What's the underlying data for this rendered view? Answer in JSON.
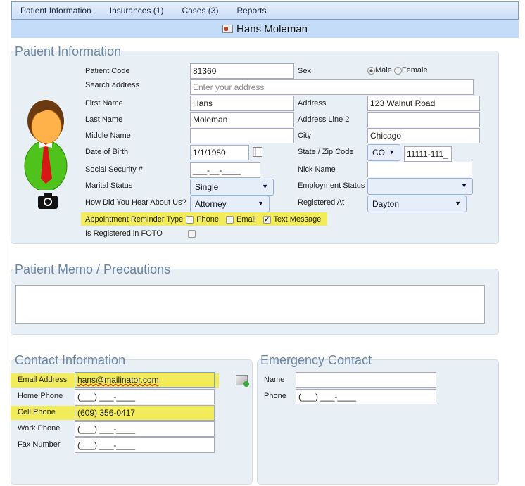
{
  "nav": {
    "tabs": [
      "Patient Information",
      "Insurances (1)",
      "Cases (3)",
      "Reports"
    ]
  },
  "title": {
    "patient_name": "Hans Moleman",
    "icon": "patient-card-icon"
  },
  "patient": {
    "heading": "Patient Information",
    "patient_code_label": "Patient Code",
    "patient_code": "81360",
    "sex_label": "Sex",
    "sex_options": [
      "Male",
      "Female"
    ],
    "sex_selected": "Male",
    "search_label": "Search address",
    "search_placeholder": "Enter your address",
    "first_name_label": "First Name",
    "first_name": "Hans",
    "address_label": "Address",
    "address": "123 Walnut Road",
    "last_name_label": "Last Name",
    "last_name": "Moleman",
    "address2_label": "Address Line 2",
    "address2": "",
    "middle_label": "Middle Name",
    "middle": "",
    "city_label": "City",
    "city": "Chicago",
    "dob_label": "Date of Birth",
    "dob": "1/1/1980",
    "state_zip_label": "State / Zip Code",
    "state": "CO",
    "zip": "11111-111_",
    "ssn_label": "Social Security #",
    "ssn": "___-__-____",
    "nick_label": "Nick Name",
    "nick": "",
    "marital_label": "Marital Status",
    "marital": "Single",
    "employment_label": "Employment Status",
    "employment": "",
    "hear_label": "How Did You Hear About Us?",
    "hear": "Attorney",
    "registered_at_label": "Registered At",
    "registered_at": "Dayton",
    "reminder_label": "Appointment Reminder Type",
    "reminders": [
      {
        "label": "Phone",
        "checked": false
      },
      {
        "label": "Email",
        "checked": false
      },
      {
        "label": "Text Message",
        "checked": true
      }
    ],
    "foto_label": "Is Registered in FOTO",
    "foto": false
  },
  "memo": {
    "heading": "Patient Memo / Precautions",
    "value": ""
  },
  "contact": {
    "heading": "Contact Information",
    "email_label": "Email Address",
    "email": "hans@mailinator.com",
    "home_label": "Home Phone",
    "home": "(___) ___-____",
    "cell_label": "Cell Phone",
    "cell": "(609) 356-0417",
    "work_label": "Work Phone",
    "work": "(___) ___-____",
    "fax_label": "Fax Number",
    "fax": "(___) ___-____"
  },
  "emergency": {
    "heading": "Emergency Contact",
    "name_label": "Name",
    "name": "",
    "phone_label": "Phone",
    "phone": "(___) ___-____"
  },
  "colors": {
    "highlight": "#f2ec5a",
    "heading": "#6a86a5",
    "panel": "#e8eff5",
    "titlebar": "#c4dcf7"
  }
}
